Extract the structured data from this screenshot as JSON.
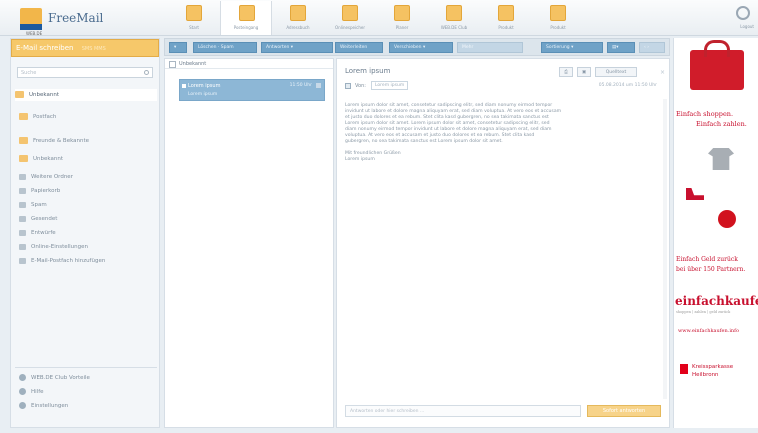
{
  "app": {
    "logo_text": "FreeMail",
    "logo_sub": "WEB.DE"
  },
  "topnav": [
    {
      "label": "Start",
      "icon": "home-icon"
    },
    {
      "label": "Posteingang",
      "icon": "inbox-icon"
    },
    {
      "label": "Adressbuch",
      "icon": "addressbook-icon"
    },
    {
      "label": "Onlinespeicher",
      "icon": "cloud-icon"
    },
    {
      "label": "Planer",
      "icon": "planner-icon"
    },
    {
      "label": "WEB.DE Club",
      "icon": "club-icon"
    },
    {
      "label": "Produkt",
      "icon": "product-icon"
    },
    {
      "label": "Produkt",
      "icon": "product2-icon"
    }
  ],
  "topnav_right": {
    "label": "Logout"
  },
  "sidebar": {
    "compose_label": "E-Mail schreiben",
    "compose_extra": "SMS  MMS",
    "search_placeholder": "Suche",
    "folders": [
      {
        "label": "Unbekannt",
        "active": true
      },
      {
        "label": "Postfach"
      },
      {
        "label": "Freunde & Bekannte"
      },
      {
        "label": "Unbekannt"
      },
      {
        "label": "Weitere Ordner"
      },
      {
        "label": "Papierkorb"
      },
      {
        "label": "Spam"
      },
      {
        "label": "Gesendet"
      },
      {
        "label": "Entwürfe"
      },
      {
        "label": "Online-Einstellungen"
      },
      {
        "label": "E-Mail-Postfach hinzufügen"
      }
    ],
    "bottom": [
      {
        "label": "WEB.DE Club Vorteile"
      },
      {
        "label": "Hilfe"
      },
      {
        "label": "Einstellungen"
      }
    ]
  },
  "toolbar": {
    "buttons": [
      "Löschen",
      "Spam",
      "Antworten",
      "Weiterleiten",
      "Verschieben",
      "Mehr",
      "Sortierung"
    ]
  },
  "list": {
    "header": "Unbekannt",
    "items": [
      {
        "sender": "Lorem ipsum",
        "date": "11:50 Uhr",
        "subject": "Lorem ipsum"
      }
    ]
  },
  "reader": {
    "subject": "Lorem ipsum",
    "from_label": "Von:",
    "from": "Lorem ipsum",
    "btn_print": "Drucken",
    "btn_view": "Ansicht",
    "btn_source": "Quelltext",
    "date": "05.08.2014 um 11:50 Uhr",
    "body": "Lorem ipsum dolor sit amet, consetetur sadipscing elitr, sed diam nonumy eirmod tempor\ninvidunt ut labore et dolore magna aliquyam erat, sed diam voluptua. At vero eos et accusam\net justo duo dolores et ea rebum. Stet clita kasd gubergren, no sea takimata sanctus est\nLorem ipsum dolor sit amet. Lorem ipsum dolor sit amet, consetetur sadipscing elitr, sed\ndiam nonumy eirmod tempor invidunt ut labore et dolore magna aliquyam erat, sed diam\nvoluptua. At vero eos et accusam et justo duo dolores et ea rebum. Stet clita kasd\ngubergren, no sea takimata sanctus est Lorem ipsum dolor sit amet.\n\nMit freundlichen Grüßen\nLorem ipsum",
    "reply_placeholder": "Antworten oder hier schreiben ...",
    "reply_button": "Sofort antworten"
  },
  "ad": {
    "line1": "Einfach shoppen.",
    "line2": "Einfach zahlen.",
    "line3": "Einfach Geld zurück",
    "line4": "bei über 150 Partnern.",
    "brand": "einfachkaufen",
    "brand_sub": "shoppen | zahlen | geld zurück",
    "url": "www.einfachkaufen.info",
    "bank1": "Kreissparkasse",
    "bank2": "Heilbronn"
  },
  "colors": {
    "accent_orange": "#f6c86a",
    "accent_blue": "#6fa2c7",
    "ad_red": "#c8102e"
  }
}
